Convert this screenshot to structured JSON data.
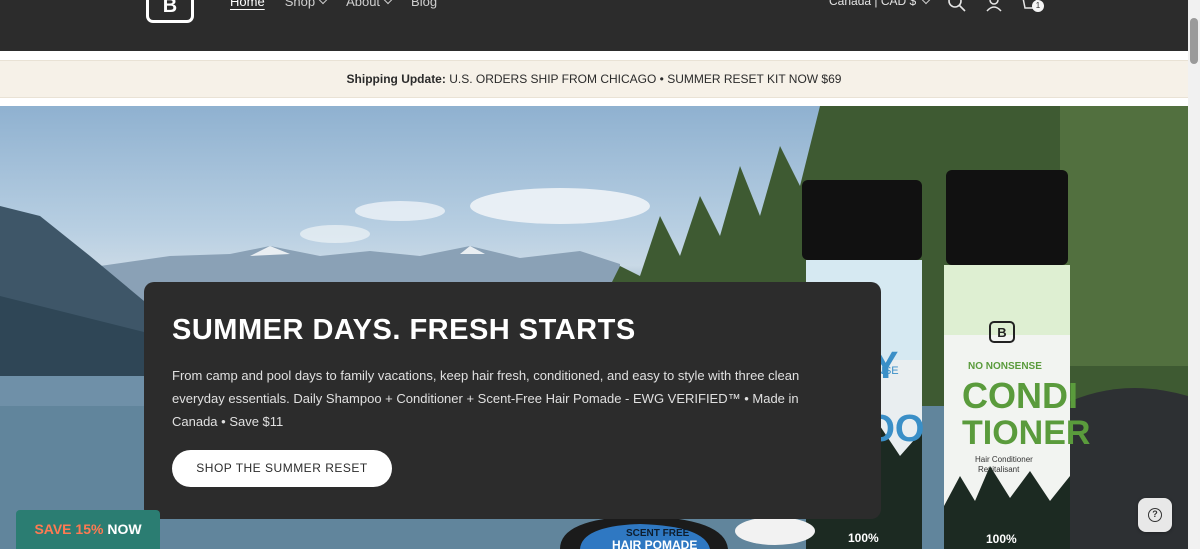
{
  "header": {
    "logo_letter": "B",
    "nav": [
      {
        "label": "Home",
        "active": true,
        "dropdown": false
      },
      {
        "label": "Shop",
        "active": false,
        "dropdown": true
      },
      {
        "label": "About",
        "active": false,
        "dropdown": true
      },
      {
        "label": "Blog",
        "active": false,
        "dropdown": false
      }
    ],
    "country": "Canada | CAD $",
    "icons": [
      "search-icon",
      "account-icon",
      "cart-icon"
    ],
    "cart_count": "1"
  },
  "announcement": {
    "bold": "Shipping Update:",
    "text": " U.S. ORDERS SHIP FROM CHICAGO • SUMMER RESET KIT NOW $69"
  },
  "hero": {
    "title": "SUMMER DAYS. FRESH STARTS",
    "body": "From camp and pool days to family vacations, keep hair fresh, conditioned, and easy to style with three clean everyday essentials. Daily Shampoo + Conditioner + Scent-Free Hair Pomade - EWG VERIFIED™ • Made in Canada • Save $11",
    "cta": "SHOP THE SUMMER RESET",
    "products": {
      "shampoo_label_a": "Y",
      "shampoo_label_b": "POO",
      "shampoo_side": "NSE",
      "conditioner_brand": "NO NONSENSE",
      "conditioner_name_1": "CONDI",
      "conditioner_name_2": "TIONER",
      "conditioner_sub_1": "Hair Conditioner",
      "conditioner_sub_2": "Revitalisant",
      "percent": "100%",
      "pomade_top": "SCENT FREE",
      "pomade_name": "HAIR POMADE",
      "logo_letter": "B"
    }
  },
  "save_badge": {
    "pct": "SAVE 15%",
    "now": " NOW"
  },
  "colors": {
    "header_bg": "#2c2c2c",
    "announce_bg": "#f6f1e8",
    "badge_bg": "#2b7d72",
    "badge_accent": "#ff7a52"
  }
}
